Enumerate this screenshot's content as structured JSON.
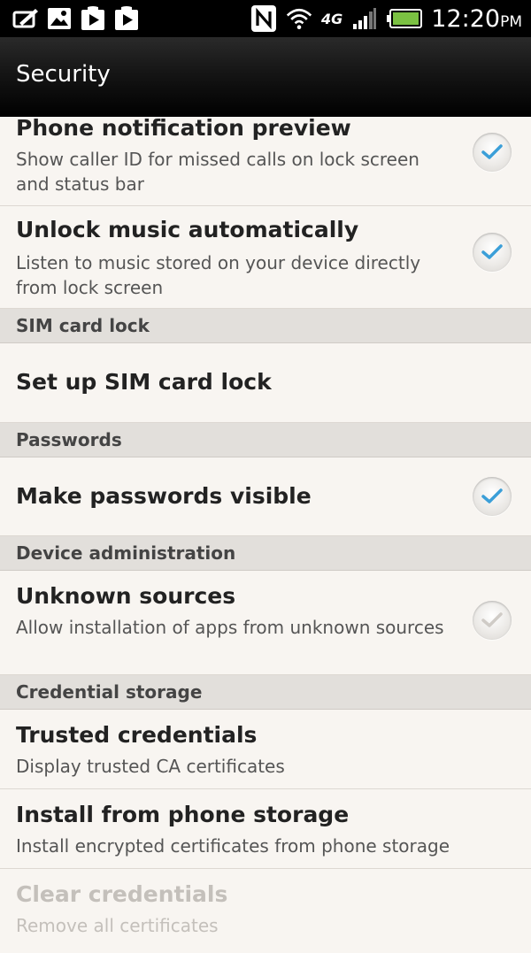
{
  "status_bar": {
    "time": "12:20",
    "ampm": "PM",
    "left_icons": [
      "message-icon",
      "gallery-icon",
      "play-store-icon",
      "play-store-icon"
    ],
    "right_icons": [
      "nfc-icon",
      "wifi-icon",
      "4g-icon",
      "signal-icon",
      "battery-icon"
    ],
    "network_label": "4G"
  },
  "action_bar": {
    "title": "Security"
  },
  "settings": [
    {
      "type": "item",
      "title": "Phone notification preview",
      "summary": "Show caller ID for missed calls on lock screen and status bar",
      "checkbox": true,
      "checked": true,
      "enabled": true
    },
    {
      "type": "item",
      "title": "Unlock music automatically",
      "summary": "Listen to music stored on your device directly from lock screen",
      "checkbox": true,
      "checked": true,
      "enabled": true
    },
    {
      "type": "header",
      "title": "SIM card lock"
    },
    {
      "type": "item",
      "title": "Set up SIM card lock",
      "summary": "",
      "checkbox": false,
      "enabled": true
    },
    {
      "type": "header",
      "title": "Passwords"
    },
    {
      "type": "item",
      "title": "Make passwords visible",
      "summary": "",
      "checkbox": true,
      "checked": true,
      "enabled": true
    },
    {
      "type": "header",
      "title": "Device administration"
    },
    {
      "type": "item",
      "title": "Unknown sources",
      "summary": "Allow installation of apps from unknown sources",
      "checkbox": true,
      "checked": false,
      "enabled": true
    },
    {
      "type": "header",
      "title": "Credential storage"
    },
    {
      "type": "item",
      "title": "Trusted credentials",
      "summary": "Display trusted CA certificates",
      "checkbox": false,
      "enabled": true
    },
    {
      "type": "item",
      "title": "Install from phone storage",
      "summary": "Install encrypted certificates from phone storage",
      "checkbox": false,
      "enabled": true
    },
    {
      "type": "item",
      "title": "Clear credentials",
      "summary": "Remove all certificates",
      "checkbox": false,
      "enabled": false
    }
  ],
  "colors": {
    "check_on": "#3b9fd8",
    "check_off": "#cfcbc6",
    "disabled_text": "#c4c0bb"
  }
}
